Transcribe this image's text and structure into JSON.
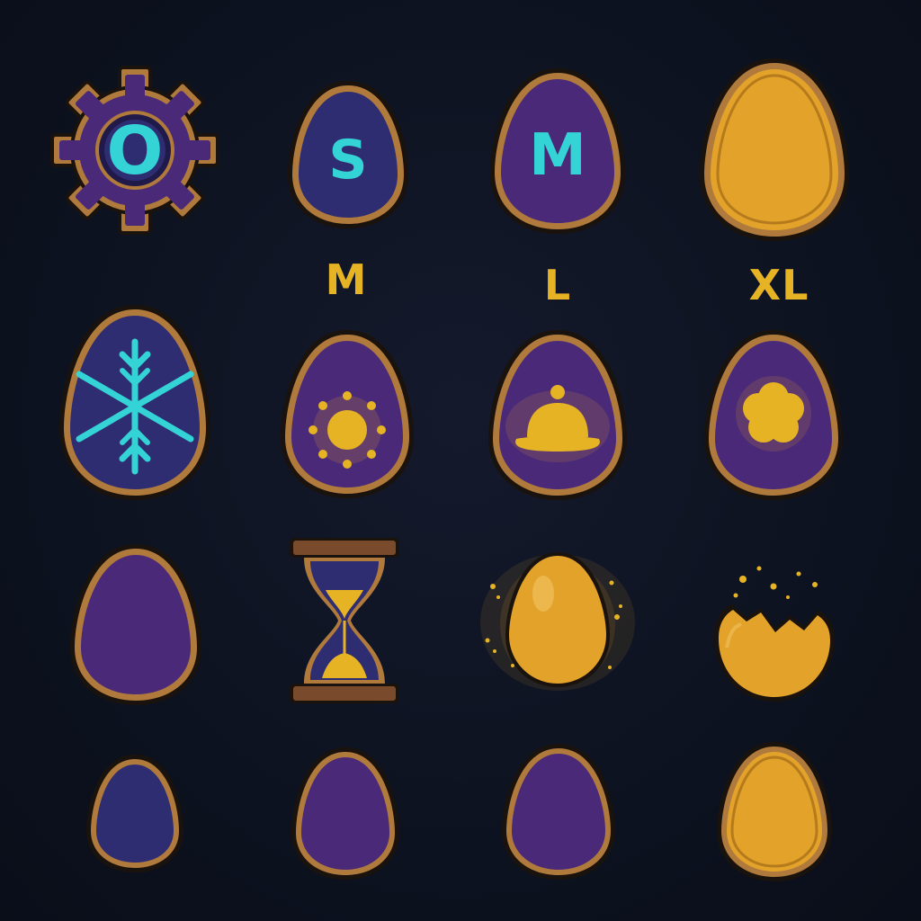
{
  "colors": {
    "background": "#0d1220",
    "frame_outer": "#1a120c",
    "frame_rim": "#b07a3c",
    "egg_blue": "#2f2d72",
    "egg_purple": "#4a2a78",
    "egg_gold": "#e3a22a",
    "accent_cyan": "#34d3d6",
    "accent_gold": "#e6b325"
  },
  "icons": {
    "settings": "gear-icon",
    "egg_small": "egg-s-icon",
    "egg_medium": "egg-m-icon",
    "egg_golden": "golden-egg-icon",
    "egg_ice": "snowflake-egg-icon",
    "egg_sun": "sun-egg-icon",
    "egg_dome": "dome-egg-icon",
    "egg_flower": "flower-egg-icon",
    "egg_plain": "plain-purple-egg-icon",
    "hourglass": "hourglass-icon",
    "egg_glowing": "glowing-golden-egg-icon",
    "egg_hatched": "hatched-egg-icon"
  },
  "eggs": {
    "small_letter": "S",
    "medium_letter": "M",
    "gear_letter": "O"
  },
  "size_labels": {
    "m": "M",
    "l": "L",
    "xl": "XL"
  }
}
